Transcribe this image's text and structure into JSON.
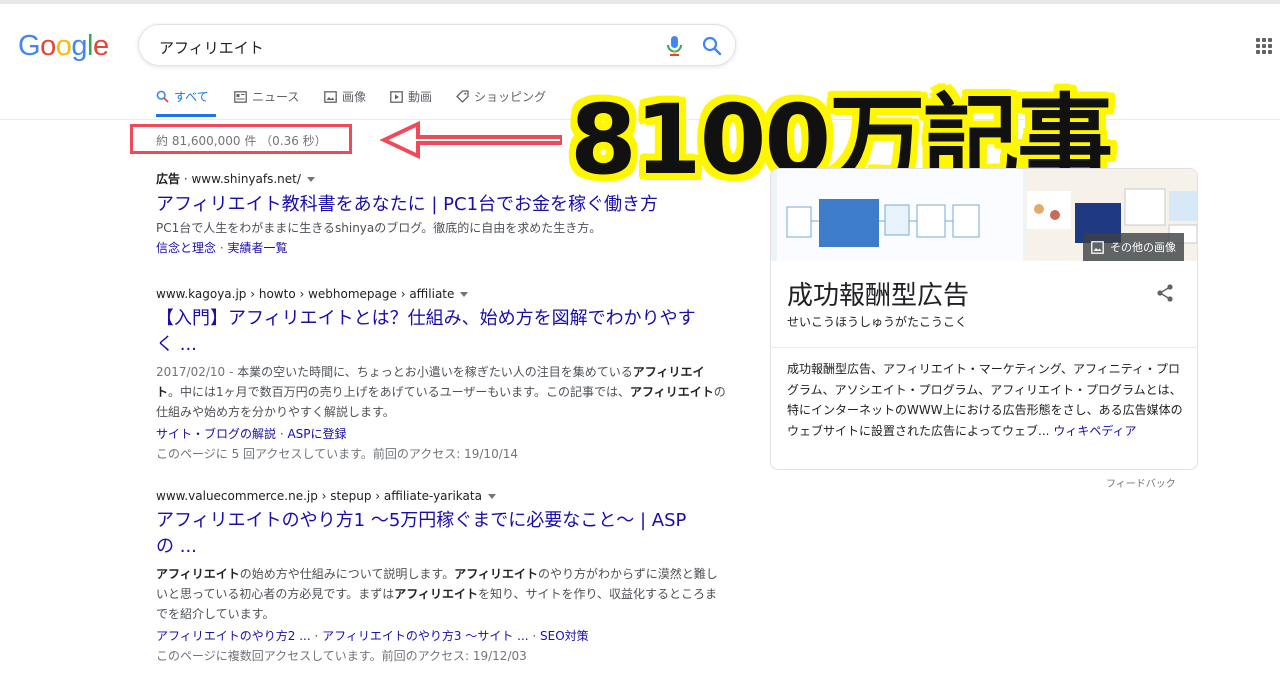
{
  "logo": {
    "text": "Google",
    "letters": [
      "G",
      "o",
      "o",
      "g",
      "l",
      "e"
    ],
    "colors": [
      "#4285f4",
      "#ea4335",
      "#fbbc05",
      "#4285f4",
      "#34a853",
      "#ea4335"
    ]
  },
  "search": {
    "query": "アフィリエイト"
  },
  "tabs": [
    {
      "label": "すべて",
      "icon": "search-icon",
      "active": true
    },
    {
      "label": "ニュース",
      "icon": "news-icon"
    },
    {
      "label": "画像",
      "icon": "image-icon"
    },
    {
      "label": "動画",
      "icon": "video-icon"
    },
    {
      "label": "ショッピング",
      "icon": "tag-icon"
    }
  ],
  "stats": "約 81,600,000 件 （0.36 秒）",
  "banner": "8100万記事",
  "results": [
    {
      "ad_label": "広告",
      "cite": "· www.shinyafs.net/",
      "title": "アフィリエイト教科書をあなたに | PC1台でお金を稼ぐ働き方",
      "snippet": "PC1台で人生をわがままに生きるshinyaのブログ。徹底的に自由を求めた生き方。",
      "sitelinks": [
        "信念と理念",
        "実績者一覧"
      ]
    },
    {
      "cite": "www.kagoya.jp › howto › webhomepage › affiliate",
      "title_line1": "【入門】アフィリエイトとは？仕組み、始め方を図解でわかりやす",
      "title_line2": "く ...",
      "date": "2017/02/10 - ",
      "snippet_parts": [
        "本業の空いた時間に、ちょっとお小遣いを稼ぎたい人の注目を集めている",
        "アフィリエイト",
        "。中には1ヶ月で数百万円の売り上げをあげているユーザーもいます。この記事では、",
        "アフィリエイト",
        "の仕組みや始め方を分かりやすく解説します。"
      ],
      "sitelinks": [
        "サイト・ブログの解説",
        "ASPに登録"
      ],
      "visited": "このページに 5 回アクセスしています。前回のアクセス: 19/10/14"
    },
    {
      "cite": "www.valuecommerce.ne.jp › stepup › affiliate-yarikata",
      "title_line1": "アフィリエイトのやり方1 〜5万円稼ぐまでに必要なこと〜 | ASP",
      "title_line2": "の ...",
      "snippet_parts": [
        "アフィリエイト",
        "の始め方や仕組みについて説明します。",
        "アフィリエイト",
        "のやり方がわからずに漠然と難しいと思っている初心者の方必見です。まずは",
        "アフィリエイト",
        "を知り、サイトを作り、収益化するところまでを紹介しています。"
      ],
      "sitelinks": [
        "アフィリエイトのやり方2 ...",
        "アフィリエイトのやり方3 〜サイト ...",
        "SEO対策"
      ],
      "visited": "このページに複数回アクセスしています。前回のアクセス: 19/12/03"
    }
  ],
  "knowledge_panel": {
    "more_images": "その他の画像",
    "title": "成功報酬型広告",
    "reading": "せいこうほうしゅうがたこうこく",
    "description": "成功報酬型広告、アフィリエイト・マーケティング、アフィニティ・プログラム、アソシエイト・プログラム、アフィリエイト・プログラムとは、特にインターネットのWWW上における広告形態をさし、ある広告媒体のウェブサイトに設置された広告によってウェブ...",
    "source": "ウィキペディア",
    "feedback": "フィードバック"
  }
}
